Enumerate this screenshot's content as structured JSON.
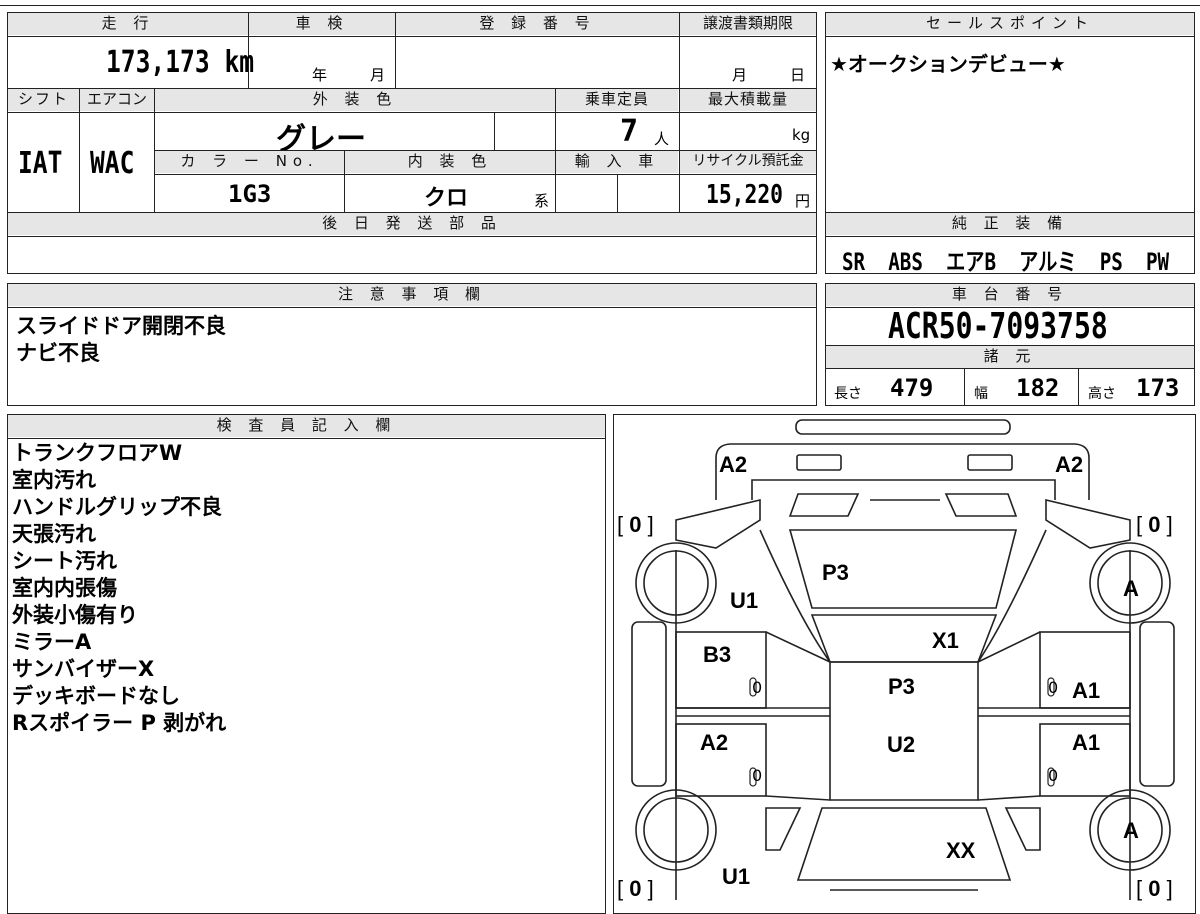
{
  "vehicle": {
    "mileage_label": "走 行",
    "mileage": "173,173 km",
    "shaken_label": "車 検",
    "shaken_year_unit": "年",
    "shaken_month_unit": "月",
    "registration_label": "登 録 番 号",
    "transfer_deadline_label": "譲渡書類期限",
    "transfer_month_unit": "月",
    "transfer_day_unit": "日",
    "shift_label": "シフト",
    "shift": "IAT",
    "aircon_label": "エアコン",
    "aircon": "WAC",
    "exterior_color_label": "外 装 色",
    "exterior_color": "グレー",
    "capacity_label": "乗車定員",
    "capacity": "7",
    "capacity_unit": "人",
    "max_load_label": "最大積載量",
    "max_load_unit": "kg",
    "color_no_label": "カ ラ ー No.",
    "color_no": "1G3",
    "interior_color_label": "内 装 色",
    "interior_color": "クロ",
    "interior_color_suffix": "系",
    "import_label": "輸 入 車",
    "recycle_label": "リサイクル預託金",
    "recycle_fee": "15,220",
    "recycle_unit": "円",
    "delivery_parts_label": "後 日 発 送 部 品"
  },
  "sales_point": {
    "label": "セールスポイント",
    "text": "★オークションデビュー★"
  },
  "equipment": {
    "label": "純 正 装 備",
    "items": [
      "SR",
      "ABS",
      "エアB",
      "アルミ",
      "PS",
      "PW"
    ]
  },
  "notes": {
    "label": "注 意 事 項 欄",
    "lines": [
      "スライドドア開閉不良",
      "ナビ不良"
    ]
  },
  "chassis": {
    "label": "車 台 番 号",
    "number": "ACR50-7093758",
    "specs_label": "諸 元",
    "length_label": "長さ",
    "length": "479",
    "width_label": "幅",
    "width": "182",
    "height_label": "高さ",
    "height": "173"
  },
  "inspector": {
    "label": "検 査 員 記 入 欄",
    "lines": [
      "トランクフロアW",
      "室内汚れ",
      "ハンドルグリップ不良",
      "天張汚れ",
      "シート汚れ",
      "室内内張傷",
      "外装小傷有り",
      "ミラーA",
      "サンバイザーX",
      "デッキボードなし",
      "Rスポイラー P 剥がれ"
    ]
  },
  "diagram": {
    "rear_left": "A2",
    "rear_right": "A2",
    "tire_rl_bracket": "0",
    "tire_rr_bracket": "0",
    "tire_fl_bracket": "0",
    "tire_fr_bracket": "0",
    "rear_glass": "P3",
    "rear_quarter_left": "U1",
    "rear_wheel_right": "A",
    "rear_door_left": "B3",
    "rear_door_left_small": "0",
    "roof_front": "X1",
    "roof": "P3",
    "rear_door_right_small": "0",
    "rear_door_right": "A1",
    "front_door_left": "A2",
    "front_door_left_small": "0",
    "roof_center": "U2",
    "front_door_right": "A1",
    "front_door_right_small": "0",
    "front_wheel_right": "A",
    "windshield": "XX",
    "front_fender_left": "U1"
  }
}
